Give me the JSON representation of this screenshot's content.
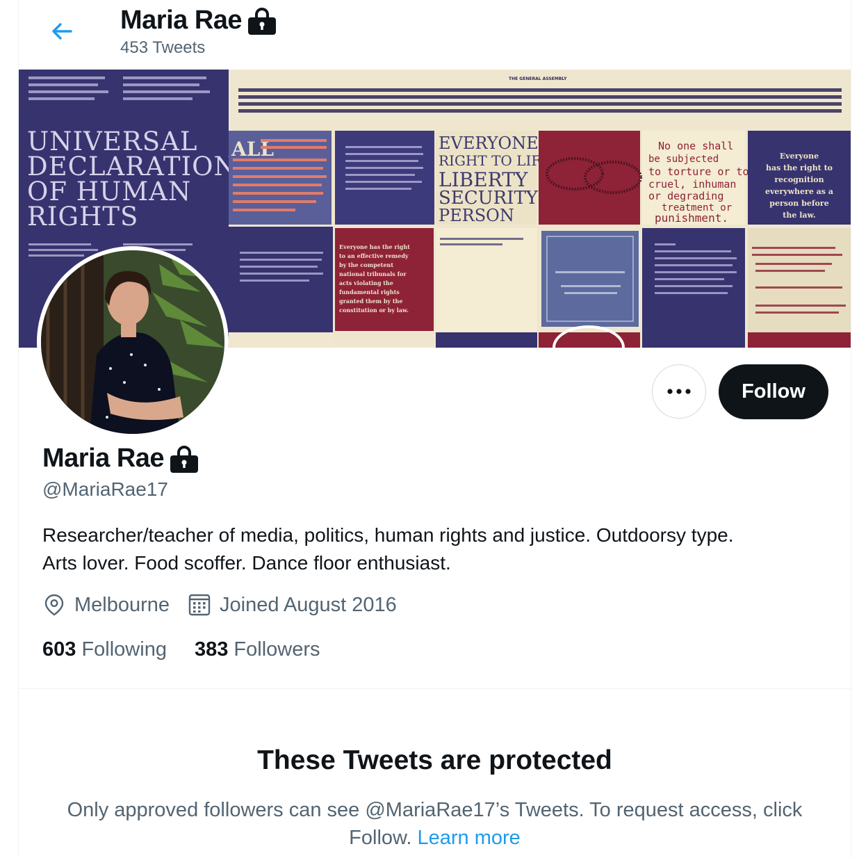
{
  "header": {
    "name": "Maria Rae",
    "tweet_count": "453 Tweets",
    "back_icon": "arrow-left-icon",
    "lock_icon": "lock-icon"
  },
  "banner": {
    "main_title_lines": [
      "UNIVERSAL",
      "DECLARATION",
      "OF HUMAN",
      "RIGHTS"
    ],
    "top_heading": "THE GENERAL ASSEMBLY",
    "tile_all": "ALL",
    "tile_everyone_lines": [
      "EVERYONE",
      "RIGHT TO LIFE",
      "LIBERTY",
      "SECURITY",
      "PERSON"
    ],
    "tile_torture_lines": [
      "No one shall",
      "be subjected",
      "to torture or to",
      "cruel, inhuman",
      "or degrading",
      "treatment or",
      "punishment."
    ],
    "tile_recognition_lines": [
      "Everyone",
      "has the right to",
      "recognition",
      "everywhere as a",
      "person before",
      "the law."
    ],
    "tile_remedy_lines": [
      "Everyone has the right",
      "to an effective remedy",
      "by the competent",
      "national tribunals for",
      "acts violating the",
      "fundamental rights",
      "granted them by the",
      "constitution or by law."
    ]
  },
  "profile": {
    "name": "Maria Rae",
    "handle": "@MariaRae17",
    "bio_lines": [
      "Researcher/teacher of media, politics, human rights and justice. Outdoorsy type.",
      "Arts lover. Food scoffer. Dance floor enthusiast."
    ],
    "location": "Melbourne",
    "joined": "Joined August 2016",
    "following_count": "603",
    "following_label": "Following",
    "followers_count": "383",
    "followers_label": "Followers"
  },
  "actions": {
    "follow_label": "Follow",
    "more_icon": "more-dots-icon"
  },
  "protected": {
    "title": "These Tweets are protected",
    "text": "Only approved followers can see @MariaRae17’s Tweets. To request access, click Follow.",
    "link": "Learn more"
  },
  "colors": {
    "accent": "#1d9bf0",
    "text_primary": "#0f1419",
    "text_secondary": "#536471",
    "follow_bg": "#0f1419",
    "banner_navy": "#3a3577",
    "banner_red": "#8e2236",
    "banner_cream": "#efe6cf"
  }
}
